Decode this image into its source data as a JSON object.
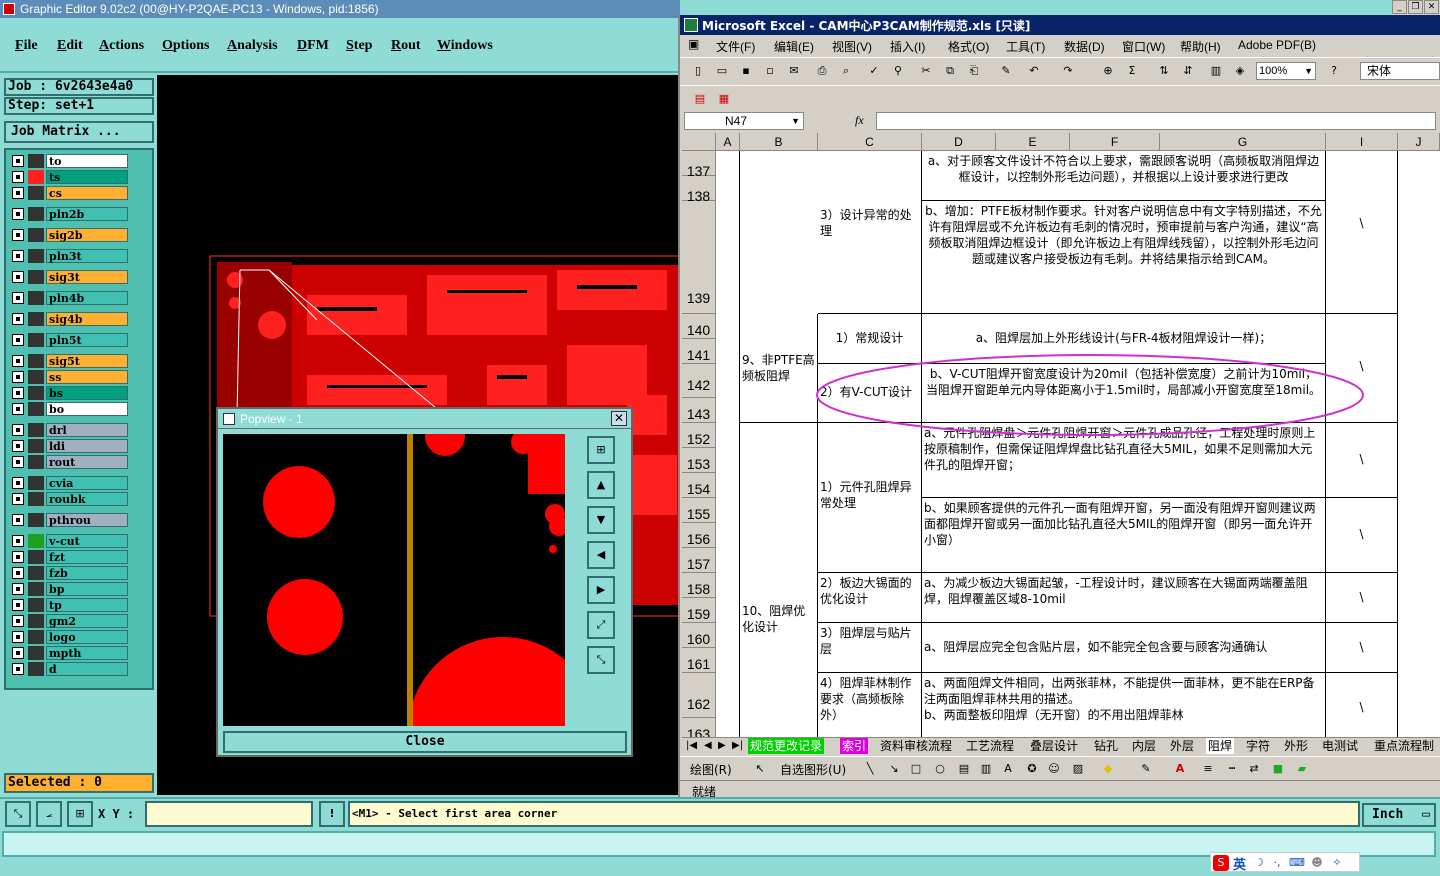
{
  "graphic_editor": {
    "title": "Graphic Editor 9.02c2 (00@HY-P2QAE-PC13 - Windows, pid:1856)",
    "menus": [
      "File",
      "Edit",
      "Actions",
      "Options",
      "Analysis",
      "DFM",
      "Step",
      "Rout",
      "Windows"
    ],
    "job_label": "Job : 6v2643e4a0",
    "step_label": "Step: set+1",
    "job_matrix_button": "Job Matrix ...",
    "layers": [
      {
        "name": "to",
        "color": "#ffffff"
      },
      {
        "name": "ts",
        "color": "#00a080"
      },
      {
        "name": "cs",
        "color": "#ffb030"
      },
      {
        "name": "pln2b",
        "color": "#40c0b0"
      },
      {
        "name": "sig2b",
        "color": "#ffb030"
      },
      {
        "name": "pln3t",
        "color": "#40c0b0"
      },
      {
        "name": "sig3t",
        "color": "#ffb030"
      },
      {
        "name": "pln4b",
        "color": "#40c0b0"
      },
      {
        "name": "sig4b",
        "color": "#ffb030"
      },
      {
        "name": "pln5t",
        "color": "#40c0b0"
      },
      {
        "name": "sig5t",
        "color": "#ffb030"
      },
      {
        "name": "ss",
        "color": "#ffb030"
      },
      {
        "name": "bs",
        "color": "#00a080"
      },
      {
        "name": "bo",
        "color": "#ffffff"
      },
      {
        "name": "drl",
        "color": "#a0b0c0"
      },
      {
        "name": "ldi",
        "color": "#a0b0c0"
      },
      {
        "name": "rout",
        "color": "#a0b0c0"
      },
      {
        "name": "cvia",
        "color": "#40c0b0"
      },
      {
        "name": "roubk",
        "color": "#40c0b0"
      },
      {
        "name": "pthrou",
        "color": "#a0b0c0"
      },
      {
        "name": "v-cut",
        "color": "#40c0b0"
      },
      {
        "name": "fzt",
        "color": "#40c0b0"
      },
      {
        "name": "fzb",
        "color": "#40c0b0"
      },
      {
        "name": "bp",
        "color": "#40c0b0"
      },
      {
        "name": "tp",
        "color": "#40c0b0"
      },
      {
        "name": "gm2",
        "color": "#40c0b0"
      },
      {
        "name": "logo",
        "color": "#40c0b0"
      },
      {
        "name": "mpth",
        "color": "#40c0b0"
      },
      {
        "name": "d",
        "color": "#40c0b0"
      }
    ],
    "selected_label": "Selected : 0",
    "xy_label": "X Y :",
    "prompt": "<M1> - Select first area corner",
    "units": "Inch"
  },
  "popview": {
    "title": "Popview - 1",
    "close_label": "Close"
  },
  "excel": {
    "title": "Microsoft Excel - CAM中心P3CAM制作规范.xls [只读]",
    "menus": [
      "文件(F)",
      "编辑(E)",
      "视图(V)",
      "插入(I)",
      "格式(O)",
      "工具(T)",
      "数据(D)",
      "窗口(W)",
      "帮助(H)",
      "Adobe PDF(B)"
    ],
    "zoom": "100%",
    "font": "宋体",
    "name_box": "N47",
    "fx": "fx",
    "columns": [
      "A",
      "B",
      "C",
      "D",
      "E",
      "F",
      "G",
      "I",
      "J"
    ],
    "rows": [
      "137",
      "138",
      "139",
      "140",
      "141",
      "142",
      "143",
      "152",
      "153",
      "154",
      "155",
      "156",
      "157",
      "158",
      "159",
      "160",
      "161",
      "162",
      "163"
    ],
    "cells": {
      "c137g": "a、对于顾客文件设计不符合以上要求，需跟顾客说明（高频板取消阻焊边框设计，以控制外形毛边问题），并根据以上设计要求进行更改",
      "c138c": "3）设计异常的处理",
      "c139g": "b、增加：PTFE板材制作要求。针对客户说明信息中有文字特别描述，不允许有阻焊层或不允许板边有毛刺的情况时，预审提前与客户沟通，建议“高频板取消阻焊边框设计（即允许板边上有阻焊线残留），以控制外形毛边问题或建议客户接受板边有毛刺。并将结果指示给到CAM。",
      "c140c": "1）常规设计",
      "c140g": "a、阻焊层加上外形线设计(与FR-4板材阻焊设计一样)；",
      "c141b": "9、非PTFE高频板阻焊",
      "c142c": "2）有V-CUT设计",
      "c142g": "b、V-CUT阻焊开窗宽度设计为20mil（包括补偿宽度）之前计为10mil，当阻焊开窗距单元内导体距离小于1.5mil时，局部减小开窗宽度至18mil。",
      "c152g": "a、元件孔阻焊盘＞元件孔阻焊开窗＞元件孔成品孔径，工程处理时原则上按原稿制作，但需保证阻焊焊盘比钻孔直径大5MIL，如果不足则需加大元件孔的阻焊开窗；",
      "c154c": "1）元件孔阻焊异常处理",
      "c155g": "b、如果顾客提供的元件孔一面有阻焊开窗，另一面没有阻焊开窗则建议两面都阻焊开窗或另一面加比钻孔直径大5MIL的阻焊开窗（即另一面允许开小窗）",
      "c158c": "2）板边大锡面的优化设计",
      "c158g": "a、为减少板边大锡面起皱，-工程设计时，建议顾客在大锡面两端覆盖阻焊，阻焊覆盖区域8-10mil",
      "c160b": "10、阻焊优化设计",
      "c160c": "3）阻焊层与贴片层",
      "c160g": "a、阻焊层应完全包含贴片层，如不能完全包含要与顾客沟通确认",
      "c162c": "4）阻焊菲林制作要求（高频板除外）",
      "c162g1": "a、两面阻焊文件相同，出两张菲林，不能提供一面菲林，更不能在ERP备注两面阻焊菲林共用的描述。",
      "c162g2": "b、两面整板印阻焊（无开窗）的不用出阻焊菲林",
      "backslash": "\\"
    },
    "tabs": [
      "规范更改记录",
      "索引",
      "资料审核流程",
      "工艺流程",
      "叠层设计",
      "钻孔",
      "内层",
      "外层",
      "阻焊",
      "字符",
      "外形",
      "电测试",
      "重点流程制作"
    ],
    "drawing_label": "绘图(R)",
    "autoshape_label": "自选图形(U)",
    "status": "就绪"
  },
  "taskbar": {
    "ime": "英"
  }
}
